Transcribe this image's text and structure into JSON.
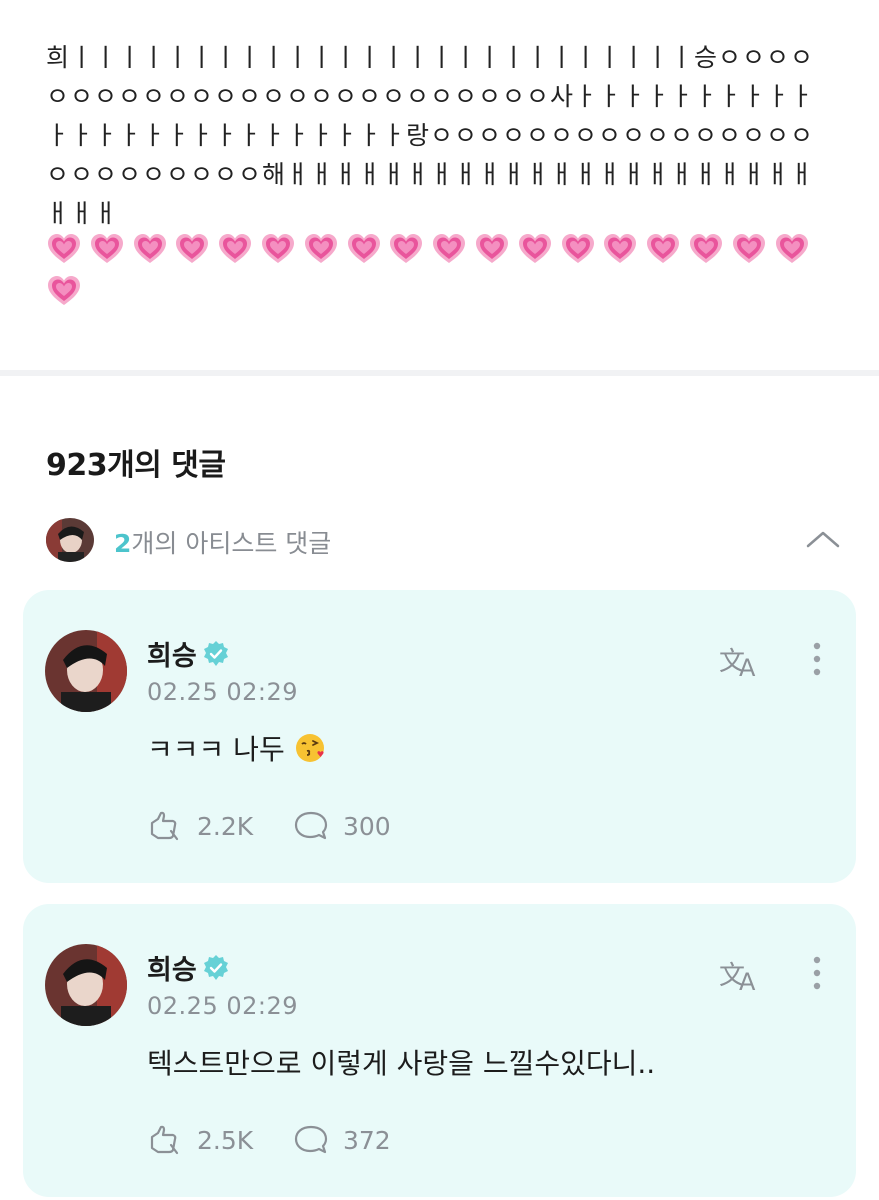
{
  "post": {
    "text": "희ㅣㅣㅣㅣㅣㅣㅣㅣㅣㅣㅣㅣㅣㅣㅣㅣㅣㅣㅣㅣㅣㅣㅣㅣㅣㅣ승ㅇㅇㅇㅇㅇㅇㅇㅇㅇㅇㅇㅇㅇㅇㅇㅇㅇㅇㅇㅇㅇㅇㅇㅇㅇ사ㅏㅏㅏㅏㅏㅏㅏㅏㅏㅏㅏㅏㅏㅏㅏㅏㅏㅏㅏㅏㅏㅏㅏㅏㅏ랑ㅇㅇㅇㅇㅇㅇㅇㅇㅇㅇㅇㅇㅇㅇㅇㅇㅇㅇㅇㅇㅇㅇㅇㅇㅇ해ㅐㅐㅐㅐㅐㅐㅐㅐㅐㅐㅐㅐㅐㅐㅐㅐㅐㅐㅐㅐㅐㅐㅐㅐㅐ",
    "hearts_count": 19,
    "heart_icon": "growing-heart-emoji"
  },
  "comments_section": {
    "title": "923개의 댓글",
    "artist_count": "2",
    "artist_label": "개의 아티스트 댓글",
    "collapse_icon": "chevron-up-icon"
  },
  "comments": [
    {
      "author": "희승",
      "time": "02.25 02:29",
      "text": "ㅋㅋㅋ 나두",
      "emoji": "face-blowing-kiss",
      "likes": "2.2K",
      "replies": "300"
    },
    {
      "author": "희승",
      "time": "02.25 02:29",
      "text": "텍스트만으로 이렇게 사랑을 느낄수있다니..",
      "likes": "2.5K",
      "replies": "372"
    }
  ],
  "colors": {
    "accent": "#4cc4cc",
    "card_bg": "#e9faf9",
    "muted": "#8b9096",
    "heart": "#e9559c"
  }
}
